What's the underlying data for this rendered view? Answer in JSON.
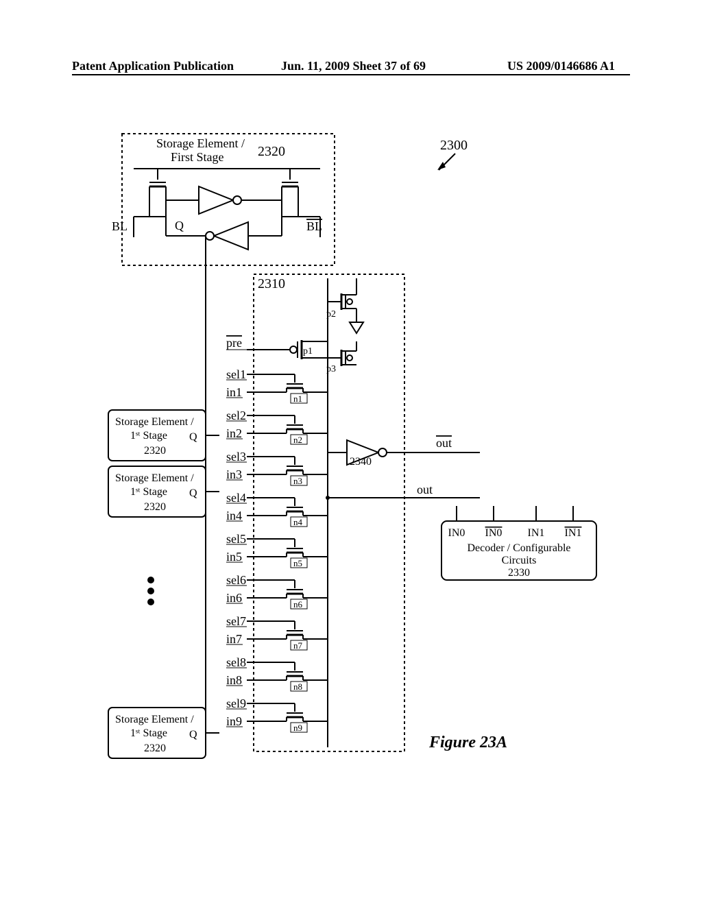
{
  "header": {
    "left": "Patent Application Publication",
    "center": "Jun. 11, 2009  Sheet 37 of 69",
    "right": "US 2009/0146686 A1"
  },
  "figure": {
    "caption": "Figure 23A",
    "ref_main": "2300",
    "storage": {
      "title1": "Storage Element /",
      "title2_full": "First Stage",
      "title2_abbr": "1ˢᵗ Stage",
      "ref": "2320",
      "q_label": "Q"
    },
    "signals": {
      "BL": "BL",
      "BL_bar": "BL",
      "pre": "pre",
      "p1": "p1",
      "p2": "p2",
      "p3": "p3",
      "out": "out",
      "out_bar": "out"
    },
    "box2310": "2310",
    "inv_ref": "2340",
    "rows": [
      {
        "sel": "sel1",
        "in": "in1",
        "n": "n1"
      },
      {
        "sel": "sel2",
        "in": "in2",
        "n": "n2"
      },
      {
        "sel": "sel3",
        "in": "in3",
        "n": "n3"
      },
      {
        "sel": "sel4",
        "in": "in4",
        "n": "n4"
      },
      {
        "sel": "sel5",
        "in": "in5",
        "n": "n5"
      },
      {
        "sel": "sel6",
        "in": "in6",
        "n": "n6"
      },
      {
        "sel": "sel7",
        "in": "in7",
        "n": "n7"
      },
      {
        "sel": "sel8",
        "in": "in8",
        "n": "n8"
      },
      {
        "sel": "sel9",
        "in": "in9",
        "n": "n9"
      }
    ],
    "decoder": {
      "in0": "IN0",
      "in0_bar": "IN0",
      "in1": "IN1",
      "in1_bar": "IN1",
      "line1": "Decoder / Configurable",
      "line2": "Circuits",
      "ref": "2330"
    }
  }
}
